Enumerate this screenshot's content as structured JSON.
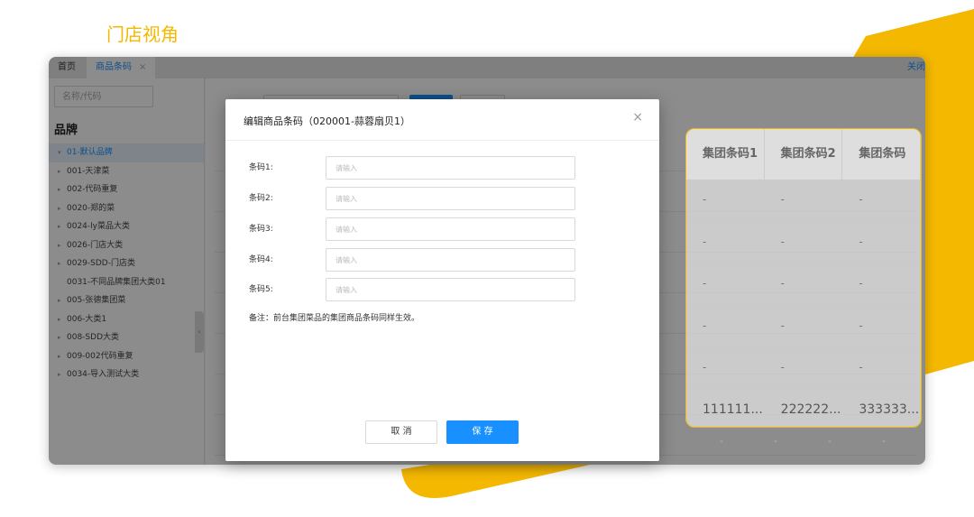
{
  "app": {
    "tabs": [
      {
        "label": "首页"
      },
      {
        "label": "商品条码",
        "close": "×"
      }
    ],
    "close_all": "关闭"
  },
  "left_panel": {
    "search_placeholder": "名称/代码",
    "brand_title": "品牌",
    "tree": [
      {
        "arrow": "▾",
        "label": "01-默认品牌"
      },
      {
        "arrow": "▸",
        "label": "001-天津菜"
      },
      {
        "arrow": "▸",
        "label": "002-代码重复"
      },
      {
        "arrow": "▸",
        "label": "0020-郑的菜"
      },
      {
        "arrow": "▸",
        "label": "0024-ly菜品大类"
      },
      {
        "arrow": "▸",
        "label": "0026-门店大类"
      },
      {
        "arrow": "▸",
        "label": "0029-SDD-门店类"
      },
      {
        "arrow": "",
        "label": "0031-不同品牌集团大类01"
      },
      {
        "arrow": "▸",
        "label": "005-张德集团菜"
      },
      {
        "arrow": "▸",
        "label": "006-大类1"
      },
      {
        "arrow": "▸",
        "label": "008-SDD大类"
      },
      {
        "arrow": "▸",
        "label": "009-002代码重复"
      },
      {
        "arrow": "▸",
        "label": "0034-导入测试大类"
      }
    ]
  },
  "overlay_label": "门店视角",
  "callout_table": {
    "headers": [
      "集团条码1",
      "集团条码2",
      "集团条码"
    ],
    "rows": [
      [
        "-",
        "-",
        "-"
      ],
      [
        "-",
        "-",
        "-"
      ],
      [
        "-",
        "-",
        "-"
      ],
      [
        "-",
        "-",
        "-"
      ],
      [
        "-",
        "-",
        "-"
      ]
    ],
    "last_row": [
      "111111...",
      "222222...",
      "333333..."
    ],
    "below_row": [
      "-",
      "-",
      "-",
      "-"
    ]
  },
  "modal": {
    "title": "编辑商品条码（020001-蒜蓉扇贝1）",
    "close": "×",
    "fields": [
      {
        "label": "条码1:",
        "placeholder": "请输入"
      },
      {
        "label": "条码2:",
        "placeholder": "请输入"
      },
      {
        "label": "条码3:",
        "placeholder": "请输入"
      },
      {
        "label": "条码4:",
        "placeholder": "请输入"
      },
      {
        "label": "条码5:",
        "placeholder": "请输入"
      }
    ],
    "note": "备注：前台集团菜品的集团商品条码同样生效。",
    "cancel_label": "取 消",
    "save_label": "保 存"
  },
  "colors": {
    "accent": "#f5b800",
    "primary": "#1890ff"
  }
}
